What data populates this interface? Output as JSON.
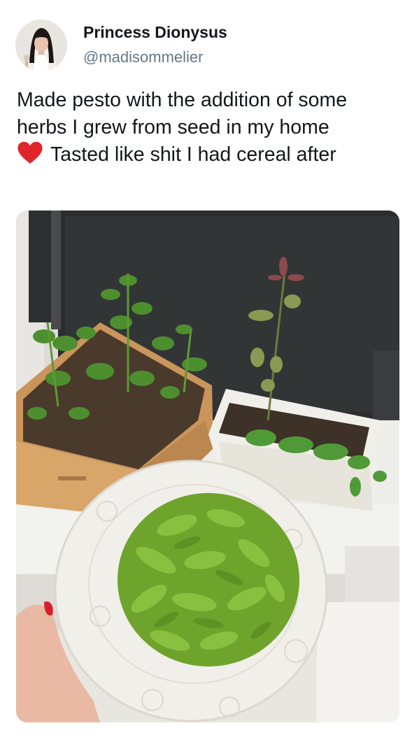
{
  "tweet": {
    "author": {
      "display_name": "Princess Dionysus",
      "handle": "@madisommelier",
      "avatar_icon": "profile-photo"
    },
    "text_lines": [
      "Made pesto with the addition of some",
      "herbs I grew from seed in my home",
      "Tasted like shit I had cereal after"
    ],
    "emoji": "red-heart-icon",
    "media": {
      "type": "photo",
      "subject": "herb planters and plate of pesto pasta"
    }
  },
  "colors": {
    "text": "#14171a",
    "secondary_text": "#657786",
    "heart": "#e0252b",
    "pesto": "#7fb33a"
  }
}
